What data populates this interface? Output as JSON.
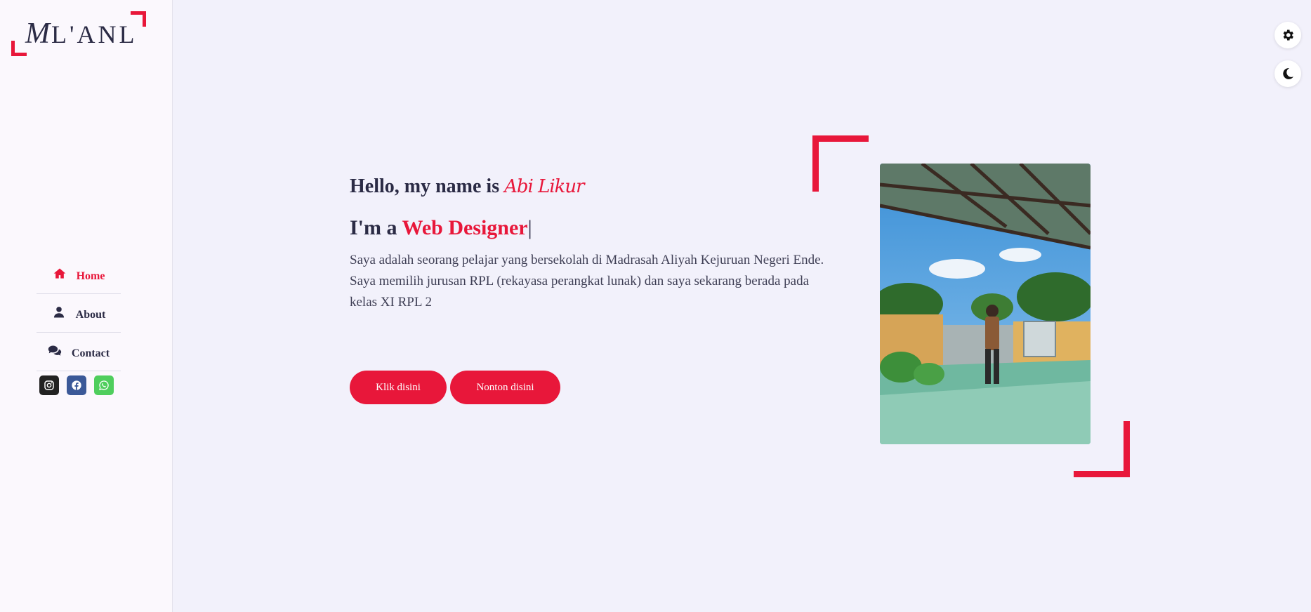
{
  "logo": {
    "text_first": "M",
    "text_rest": "L'ANL"
  },
  "nav": {
    "items": [
      {
        "label": "Home",
        "icon": "home-icon",
        "active": true
      },
      {
        "label": "About",
        "icon": "user-icon",
        "active": false
      },
      {
        "label": "Contact",
        "icon": "comments-icon",
        "active": false
      }
    ]
  },
  "socials": [
    {
      "name": "instagram-icon",
      "color": "#222222"
    },
    {
      "name": "facebook-icon",
      "color": "#3b5998"
    },
    {
      "name": "whatsapp-icon",
      "color": "#4fce5d"
    }
  ],
  "floating": {
    "settings_icon": "gear-icon",
    "theme_icon": "moon-icon"
  },
  "hero": {
    "greeting_prefix": "Hello, my name is",
    "name": "Abi Likur",
    "role_prefix": "I'm a",
    "role": "Web Designer",
    "cursor": "|",
    "description": "Saya adalah seorang pelajar yang bersekolah di Madrasah Aliyah Kejuruan Negeri Ende. Saya memilih jurusan RPL (rekayasa perangkat lunak) dan saya sekarang berada pada kelas XI RPL 2",
    "primary_button": "Klik disini",
    "secondary_button": "Nonton disini"
  },
  "colors": {
    "accent": "#e8173a",
    "text": "#2b2b45",
    "background": "#f2f1fb",
    "sidebar": "#fbf8fd"
  }
}
